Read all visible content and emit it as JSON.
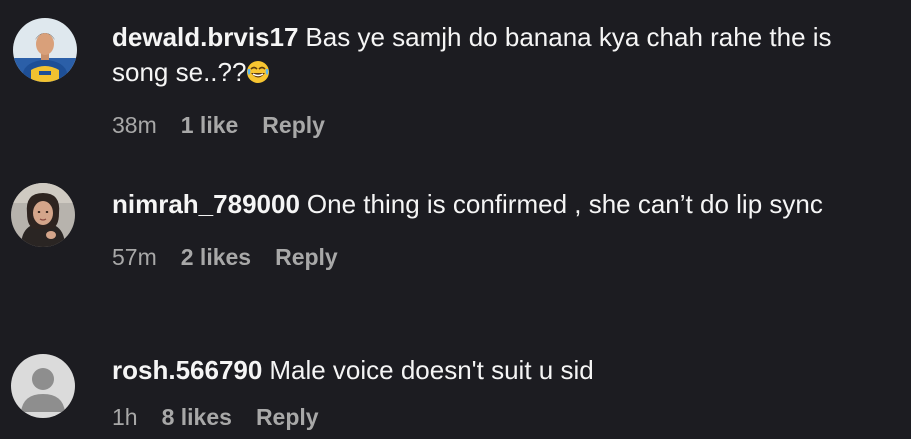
{
  "comments": [
    {
      "username": "dewald.brvis17",
      "text": "Bas ye samjh do banana kya chah rahe the is song se..??",
      "emoji": "😂",
      "time": "38m",
      "likes": "1 like",
      "reply": "Reply",
      "avatar_icon": "profile-photo"
    },
    {
      "username": "nimrah_789000",
      "text": "One thing is confirmed , she can’t do lip sync",
      "time": "57m",
      "likes": "2 likes",
      "reply": "Reply",
      "avatar_icon": "profile-photo"
    },
    {
      "username": "rosh.566790",
      "text": "Male voice doesn't suit u sid",
      "time": "1h",
      "likes": "8 likes",
      "reply": "Reply",
      "avatar_icon": "default-avatar"
    }
  ],
  "colors": {
    "background": "#1c1c21",
    "primary_text": "#f5f5f5",
    "secondary_text": "#a8a8a8"
  }
}
